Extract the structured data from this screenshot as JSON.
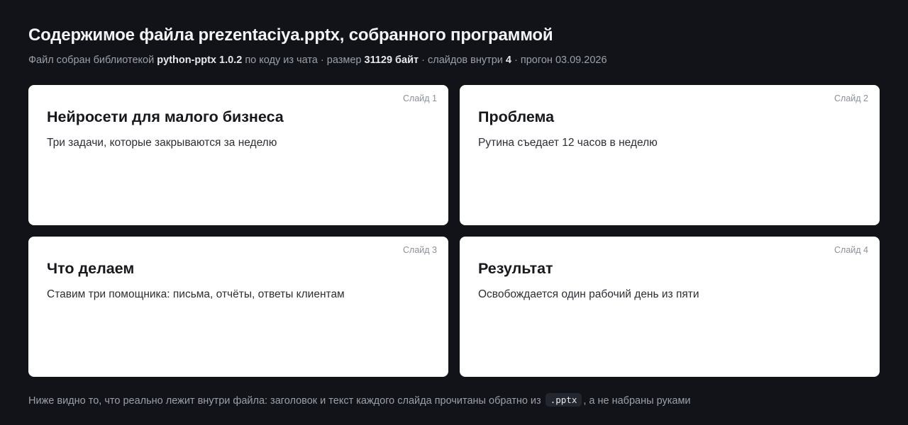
{
  "header": {
    "title": "Содержимое файла prezentaciya.pptx, собранного программой",
    "meta": {
      "prefix": "Файл собран библиотекой",
      "library": "python-pptx 1.0.2",
      "middle": "по коду из чата · размер",
      "size": "31129 байт",
      "slides_label": "· слайдов внутри",
      "slides_count": "4",
      "run": "· прогон 03.09.2026"
    }
  },
  "slides": [
    {
      "label": "Слайд 1",
      "title": "Нейросети для малого бизнеса",
      "text": "Три задачи, которые закрываются за неделю"
    },
    {
      "label": "Слайд 2",
      "title": "Проблема",
      "text": "Рутина съедает 12 часов в неделю"
    },
    {
      "label": "Слайд 3",
      "title": "Что делаем",
      "text": "Ставим три помощника: письма, отчёты, ответы клиентам"
    },
    {
      "label": "Слайд 4",
      "title": "Результат",
      "text": "Освобождается один рабочий день из пяти"
    }
  ],
  "footer": {
    "before": "Ниже видно то, что реально лежит внутри файла: заголовок и текст каждого слайда прочитаны обратно из",
    "code": ".pptx",
    "after": ", а не набраны руками"
  },
  "colors": {
    "background": "#111318",
    "card": "#ffffff",
    "muted": "#9aa0ab"
  }
}
